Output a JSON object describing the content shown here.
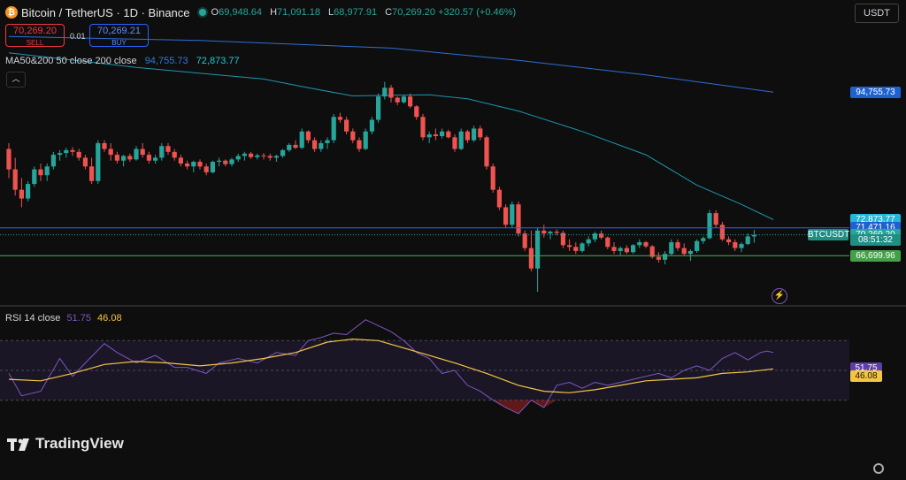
{
  "header": {
    "title": "Bitcoin / TetherUS · 1D · Binance",
    "coin_glyph": "₿",
    "ohlc": [
      {
        "k": "O",
        "v": "69,948.64"
      },
      {
        "k": "H",
        "v": "71,091.18"
      },
      {
        "k": "L",
        "v": "68,977.91"
      },
      {
        "k": "C",
        "v": "70,269.20 +320.57 (+0.46%)"
      }
    ]
  },
  "trade": {
    "sell_price": "70,269.20",
    "sell_label": "SELL",
    "buy_price": "70,269.21",
    "buy_label": "BUY",
    "spread": "0.01"
  },
  "currency_select": "USDT",
  "ma_legend": {
    "name": "MA50&200",
    "params": "50 close 200 close",
    "v1": "94,755.73",
    "v2": "72,873.77"
  },
  "rsi_legend": {
    "name": "RSI 14 close",
    "v1": "51.75",
    "v2": "46.08"
  },
  "price_labels": [
    {
      "text": "94,755.73",
      "color": "#1e62d0",
      "price": 94755.73
    },
    {
      "text": "72,873.77",
      "color": "#22b8d8",
      "price": 72873.77
    },
    {
      "text": "71,471.16",
      "color": "#1e62d0",
      "price": 71471.16
    },
    {
      "text": "70,269.20",
      "color": "#26a69a",
      "price": 70269.2
    },
    {
      "text": "08:51:32",
      "color": "#1f8f84",
      "price": 69370
    },
    {
      "text": "66,699.96",
      "color": "#43a047",
      "price": 66699.96
    }
  ],
  "symbol_tag": "BTCUSDT",
  "rsi_labels": [
    {
      "text": "51.75",
      "color": "#5e3fa8",
      "value": 51.75
    },
    {
      "text": "46.08",
      "color": "#f5c542",
      "value": 46.08
    }
  ],
  "brand": "TradingView",
  "colors": {
    "up": "#26a69a",
    "down": "#ef5350",
    "ma50": "#22b8d8",
    "ma200": "#2e6fd6",
    "rsi": "#7e57c2",
    "rsi_ma": "#f5c542"
  },
  "chart_data": [
    {
      "type": "candlestick",
      "title": "Bitcoin / TetherUS · 1D · Binance",
      "ylim": [
        59000,
        106000
      ],
      "candles": [
        [
          85000,
          86000,
          80000,
          81500
        ],
        [
          81500,
          83500,
          77000,
          78000
        ],
        [
          78000,
          80000,
          75000,
          76500
        ],
        [
          76500,
          79500,
          76000,
          79000
        ],
        [
          79000,
          82000,
          78500,
          81500
        ],
        [
          81500,
          82500,
          79500,
          80500
        ],
        [
          80500,
          82500,
          79500,
          82000
        ],
        [
          82000,
          84500,
          81500,
          84000
        ],
        [
          84000,
          84800,
          83000,
          84300
        ],
        [
          84300,
          85200,
          83500,
          84800
        ],
        [
          84800,
          85300,
          83800,
          84500
        ],
        [
          84500,
          85000,
          83000,
          83500
        ],
        [
          83500,
          84000,
          81500,
          82000
        ],
        [
          82000,
          83500,
          79000,
          79500
        ],
        [
          79500,
          86500,
          79000,
          86000
        ],
        [
          86000,
          86500,
          84500,
          85000
        ],
        [
          85000,
          86000,
          83000,
          84000
        ],
        [
          84000,
          84500,
          82500,
          83000
        ],
        [
          83000,
          84000,
          82000,
          83800
        ],
        [
          83800,
          84200,
          82800,
          83200
        ],
        [
          83200,
          85500,
          83000,
          85000
        ],
        [
          85000,
          86000,
          83500,
          84000
        ],
        [
          84000,
          84500,
          82500,
          83000
        ],
        [
          83000,
          84000,
          82500,
          83500
        ],
        [
          83500,
          86000,
          83000,
          85500
        ],
        [
          85500,
          86000,
          84000,
          84500
        ],
        [
          84500,
          85000,
          83000,
          83500
        ],
        [
          83500,
          84000,
          82000,
          82500
        ],
        [
          82500,
          83000,
          81500,
          82000
        ],
        [
          82000,
          83000,
          81000,
          82800
        ],
        [
          82800,
          83200,
          81500,
          82000
        ],
        [
          82000,
          82500,
          80500,
          81000
        ],
        [
          81000,
          83000,
          80800,
          82800
        ],
        [
          82800,
          83500,
          82000,
          83000
        ],
        [
          83000,
          83200,
          82000,
          82400
        ],
        [
          82400,
          83500,
          82000,
          83200
        ],
        [
          83200,
          84200,
          82800,
          83800
        ],
        [
          83800,
          84500,
          83000,
          84200
        ],
        [
          84200,
          84500,
          83300,
          83600
        ],
        [
          83600,
          84200,
          83200,
          83900
        ],
        [
          83900,
          84300,
          83200,
          83800
        ],
        [
          83800,
          84200,
          83000,
          83500
        ],
        [
          83500,
          84000,
          82800,
          83800
        ],
        [
          83800,
          85000,
          83500,
          84800
        ],
        [
          84800,
          86000,
          84500,
          85700
        ],
        [
          85700,
          86500,
          85000,
          85200
        ],
        [
          85200,
          88500,
          85000,
          88000
        ],
        [
          88000,
          88200,
          86000,
          86500
        ],
        [
          86500,
          87000,
          84500,
          85000
        ],
        [
          85000,
          86500,
          84500,
          86000
        ],
        [
          86000,
          87000,
          85000,
          86500
        ],
        [
          86500,
          91000,
          86000,
          90500
        ],
        [
          90500,
          91200,
          89500,
          90000
        ],
        [
          90000,
          90500,
          87500,
          88000
        ],
        [
          88000,
          88500,
          86000,
          86500
        ],
        [
          86500,
          87000,
          84500,
          85000
        ],
        [
          85000,
          88500,
          84800,
          88000
        ],
        [
          88000,
          90500,
          87500,
          90000
        ],
        [
          90000,
          94500,
          89500,
          94000
        ],
        [
          94000,
          96500,
          93500,
          95500
        ],
        [
          95500,
          96000,
          93000,
          93800
        ],
        [
          93800,
          94000,
          92500,
          93000
        ],
        [
          93000,
          94300,
          92800,
          94000
        ],
        [
          94000,
          94500,
          92000,
          92300
        ],
        [
          92300,
          92500,
          90000,
          90500
        ],
        [
          90500,
          91000,
          86500,
          87000
        ],
        [
          87000,
          88000,
          86000,
          87500
        ],
        [
          87500,
          88500,
          86500,
          87200
        ],
        [
          87200,
          88500,
          86800,
          88000
        ],
        [
          88000,
          88300,
          86800,
          87000
        ],
        [
          87000,
          87500,
          84500,
          85000
        ],
        [
          85000,
          88500,
          84800,
          88000
        ],
        [
          88000,
          88300,
          86000,
          86500
        ],
        [
          86500,
          89000,
          86200,
          88500
        ],
        [
          88500,
          89000,
          86500,
          87000
        ],
        [
          87000,
          87300,
          81500,
          82000
        ],
        [
          82000,
          82500,
          77500,
          78000
        ],
        [
          78000,
          78500,
          74500,
          75000
        ],
        [
          75000,
          75500,
          71500,
          72000
        ],
        [
          72000,
          76000,
          71500,
          75500
        ],
        [
          75500,
          76000,
          70000,
          70500
        ],
        [
          70500,
          71000,
          67500,
          68000
        ],
        [
          68000,
          71000,
          64000,
          64500
        ],
        [
          64500,
          71500,
          60500,
          71000
        ],
        [
          71000,
          72000,
          69800,
          70500
        ],
        [
          70500,
          71000,
          69500,
          70800
        ],
        [
          70800,
          71200,
          70200,
          70600
        ],
        [
          70600,
          71000,
          68000,
          68500
        ],
        [
          68500,
          69500,
          67500,
          68200
        ],
        [
          68200,
          69000,
          67000,
          67500
        ],
        [
          67500,
          69000,
          67200,
          68800
        ],
        [
          68800,
          70000,
          68300,
          69500
        ],
        [
          69500,
          70800,
          69000,
          70500
        ],
        [
          70500,
          71000,
          69500,
          69800
        ],
        [
          69800,
          70000,
          67800,
          68200
        ],
        [
          68200,
          69000,
          67000,
          67500
        ],
        [
          67500,
          68300,
          66800,
          68000
        ],
        [
          68000,
          68500,
          67000,
          67300
        ],
        [
          67300,
          68700,
          67000,
          68500
        ],
        [
          68500,
          69500,
          68000,
          69000
        ],
        [
          69000,
          69200,
          68000,
          68300
        ],
        [
          68300,
          68500,
          66200,
          66500
        ],
        [
          66500,
          67300,
          65500,
          66000
        ],
        [
          66000,
          67500,
          65200,
          67000
        ],
        [
          67000,
          69500,
          66800,
          69000
        ],
        [
          69000,
          69500,
          67500,
          68000
        ],
        [
          68000,
          68800,
          66800,
          67000
        ],
        [
          67000,
          67800,
          65800,
          67500
        ],
        [
          67500,
          69500,
          67200,
          69200
        ],
        [
          69200,
          70000,
          68700,
          69700
        ],
        [
          69700,
          74500,
          69500,
          74000
        ],
        [
          74000,
          74500,
          71500,
          72000
        ],
        [
          72000,
          72500,
          69200,
          69500
        ],
        [
          69500,
          70000,
          68500,
          69000
        ],
        [
          69000,
          69500,
          67500,
          68000
        ],
        [
          68000,
          69000,
          67300,
          68700
        ],
        [
          68700,
          70500,
          68500,
          70000
        ],
        [
          70000,
          71100,
          68900,
          70269
        ]
      ],
      "ma50": [
        [
          0,
          101500
        ],
        [
          20,
          99000
        ],
        [
          40,
          97000
        ],
        [
          47,
          95500
        ],
        [
          54,
          94100
        ],
        [
          60,
          94200
        ],
        [
          66,
          94300
        ],
        [
          72,
          93600
        ],
        [
          80,
          91500
        ],
        [
          90,
          88000
        ],
        [
          100,
          84000
        ],
        [
          108,
          78800
        ],
        [
          115,
          75500
        ],
        [
          120,
          72874
        ]
      ],
      "ma200": [
        [
          0,
          104300
        ],
        [
          30,
          103600
        ],
        [
          60,
          102300
        ],
        [
          80,
          100200
        ],
        [
          100,
          97700
        ],
        [
          120,
          94756
        ]
      ]
    },
    {
      "type": "line",
      "title": "RSI 14 close",
      "ylim": [
        15,
        85
      ],
      "rsi": [
        [
          0,
          48
        ],
        [
          2,
          33
        ],
        [
          5,
          36
        ],
        [
          8,
          58
        ],
        [
          10,
          46
        ],
        [
          12,
          55
        ],
        [
          15,
          68
        ],
        [
          17,
          62
        ],
        [
          20,
          55
        ],
        [
          23,
          60
        ],
        [
          26,
          52
        ],
        [
          28,
          52
        ],
        [
          31,
          48
        ],
        [
          33,
          55
        ],
        [
          36,
          58
        ],
        [
          39,
          55
        ],
        [
          42,
          62
        ],
        [
          45,
          60
        ],
        [
          47,
          70
        ],
        [
          49,
          72
        ],
        [
          51,
          75
        ],
        [
          53,
          74
        ],
        [
          56,
          84
        ],
        [
          58,
          80
        ],
        [
          60,
          76
        ],
        [
          62,
          70
        ],
        [
          64,
          62
        ],
        [
          66,
          58
        ],
        [
          68,
          48
        ],
        [
          70,
          50
        ],
        [
          72,
          40
        ],
        [
          74,
          36
        ],
        [
          76,
          30
        ],
        [
          78,
          25
        ],
        [
          80,
          21
        ],
        [
          82,
          30
        ],
        [
          84,
          25
        ],
        [
          86,
          40
        ],
        [
          88,
          42
        ],
        [
          90,
          38
        ],
        [
          92,
          42
        ],
        [
          94,
          40
        ],
        [
          96,
          42
        ],
        [
          98,
          44
        ],
        [
          100,
          46
        ],
        [
          102,
          48
        ],
        [
          104,
          45
        ],
        [
          106,
          50
        ],
        [
          108,
          53
        ],
        [
          110,
          50
        ],
        [
          112,
          58
        ],
        [
          114,
          62
        ],
        [
          116,
          57
        ],
        [
          118,
          62
        ],
        [
          119,
          63
        ],
        [
          120,
          62
        ]
      ],
      "rsi_ma": [
        [
          0,
          44
        ],
        [
          5,
          43
        ],
        [
          10,
          48
        ],
        [
          15,
          54
        ],
        [
          20,
          56
        ],
        [
          25,
          55
        ],
        [
          30,
          53
        ],
        [
          35,
          55
        ],
        [
          40,
          58
        ],
        [
          45,
          62
        ],
        [
          50,
          69
        ],
        [
          54,
          71
        ],
        [
          58,
          70
        ],
        [
          62,
          65
        ],
        [
          66,
          60
        ],
        [
          70,
          55
        ],
        [
          75,
          48
        ],
        [
          80,
          40
        ],
        [
          84,
          36
        ],
        [
          88,
          35
        ],
        [
          92,
          37
        ],
        [
          96,
          40
        ],
        [
          100,
          43
        ],
        [
          104,
          44
        ],
        [
          108,
          45
        ],
        [
          112,
          48
        ],
        [
          116,
          49
        ],
        [
          120,
          51
        ]
      ]
    }
  ]
}
